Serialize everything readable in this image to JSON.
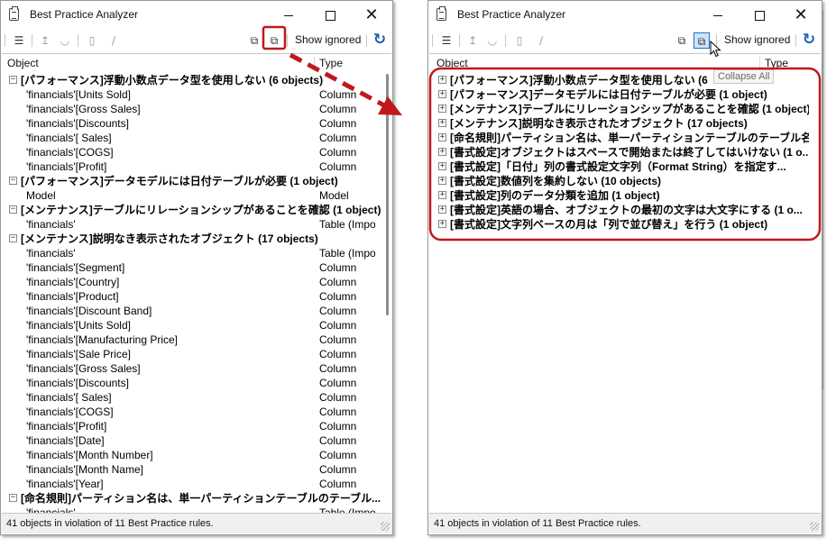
{
  "colors": {
    "arrow": "#c0181c",
    "highlight": "#c0181c",
    "refresh": "#1a5fb4"
  },
  "left_window": {
    "title": "Best Practice Analyzer",
    "toolbar": {
      "show_ignored": "Show ignored"
    },
    "columns": {
      "object": "Object",
      "type": "Type"
    },
    "rows": [
      {
        "kind": "group",
        "text": "[パフォーマンス]浮動小数点データ型を使用しない (6 objects)"
      },
      {
        "kind": "item",
        "object": "'financials'[Units Sold]",
        "type": "Column"
      },
      {
        "kind": "item",
        "object": "'financials'[Gross Sales]",
        "type": "Column"
      },
      {
        "kind": "item",
        "object": "'financials'[Discounts]",
        "type": "Column"
      },
      {
        "kind": "item",
        "object": "'financials'[ Sales]",
        "type": "Column"
      },
      {
        "kind": "item",
        "object": "'financials'[COGS]",
        "type": "Column"
      },
      {
        "kind": "item",
        "object": "'financials'[Profit]",
        "type": "Column"
      },
      {
        "kind": "group",
        "text": "[パフォーマンス]データモデルには日付テーブルが必要 (1 object)"
      },
      {
        "kind": "item",
        "object": "Model",
        "type": "Model"
      },
      {
        "kind": "group",
        "text": "[メンテナンス]テーブルにリレーションシップがあることを確認 (1 object)"
      },
      {
        "kind": "item",
        "object": "'financials'",
        "type": "Table (Impo"
      },
      {
        "kind": "group",
        "text": "[メンテナンス]説明なき表示されたオブジェクト (17 objects)"
      },
      {
        "kind": "item",
        "object": "'financials'",
        "type": "Table (Impo"
      },
      {
        "kind": "item",
        "object": "'financials'[Segment]",
        "type": "Column"
      },
      {
        "kind": "item",
        "object": "'financials'[Country]",
        "type": "Column"
      },
      {
        "kind": "item",
        "object": "'financials'[Product]",
        "type": "Column"
      },
      {
        "kind": "item",
        "object": "'financials'[Discount Band]",
        "type": "Column"
      },
      {
        "kind": "item",
        "object": "'financials'[Units Sold]",
        "type": "Column"
      },
      {
        "kind": "item",
        "object": "'financials'[Manufacturing Price]",
        "type": "Column"
      },
      {
        "kind": "item",
        "object": "'financials'[Sale Price]",
        "type": "Column"
      },
      {
        "kind": "item",
        "object": "'financials'[Gross Sales]",
        "type": "Column"
      },
      {
        "kind": "item",
        "object": "'financials'[Discounts]",
        "type": "Column"
      },
      {
        "kind": "item",
        "object": "'financials'[ Sales]",
        "type": "Column"
      },
      {
        "kind": "item",
        "object": "'financials'[COGS]",
        "type": "Column"
      },
      {
        "kind": "item",
        "object": "'financials'[Profit]",
        "type": "Column"
      },
      {
        "kind": "item",
        "object": "'financials'[Date]",
        "type": "Column"
      },
      {
        "kind": "item",
        "object": "'financials'[Month Number]",
        "type": "Column"
      },
      {
        "kind": "item",
        "object": "'financials'[Month Name]",
        "type": "Column"
      },
      {
        "kind": "item",
        "object": "'financials'[Year]",
        "type": "Column"
      },
      {
        "kind": "group",
        "text": "[命名規則]パーティション名は、単一パーティションテーブルのテーブル..."
      },
      {
        "kind": "item",
        "object": "'financials'",
        "type": "Table (Impo"
      }
    ],
    "status": "41 objects in violation of 11 Best Practice rules."
  },
  "right_window": {
    "title": "Best Practice Analyzer",
    "toolbar": {
      "show_ignored": "Show ignored"
    },
    "tooltip": "Collapse All",
    "columns": {
      "object": "Object",
      "type": "Type"
    },
    "rows": [
      {
        "kind": "group",
        "text": "[パフォーマンス]浮動小数点データ型を使用しない (6"
      },
      {
        "kind": "group",
        "text": "[パフォーマンス]データモデルには日付テーブルが必要 (1 object)"
      },
      {
        "kind": "group",
        "text": "[メンテナンス]テーブルにリレーションシップがあることを確認 (1 object)"
      },
      {
        "kind": "group",
        "text": "[メンテナンス]説明なき表示されたオブジェクト (17 objects)"
      },
      {
        "kind": "group",
        "text": "[命名規則]パーティション名は、単一パーティションテーブルのテーブル名..."
      },
      {
        "kind": "group",
        "text": "[書式設定]オブジェクトはスペースで開始または終了してはいけない (1 o..."
      },
      {
        "kind": "group",
        "text": "[書式設定]「日付」列の書式設定文字列（Format String）を指定す..."
      },
      {
        "kind": "group",
        "text": "[書式設定]数値列を集約しない (10 objects)"
      },
      {
        "kind": "group",
        "text": "[書式設定]列のデータ分類を追加 (1 object)"
      },
      {
        "kind": "group",
        "text": "[書式設定]英語の場合、オブジェクトの最初の文字は大文字にする (1 o..."
      },
      {
        "kind": "group",
        "text": "[書式設定]文字列ベースの月は「列で並び替え」を行う (1 object)"
      }
    ],
    "status": "41 objects in violation of 11 Best Practice rules."
  }
}
